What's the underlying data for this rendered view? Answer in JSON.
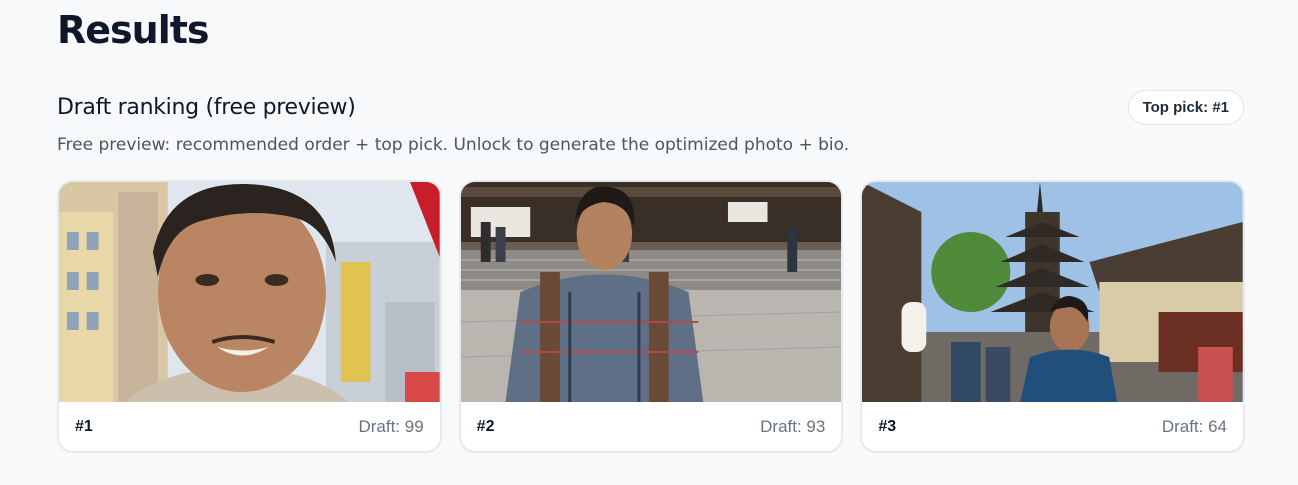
{
  "page": {
    "title": "Results"
  },
  "section": {
    "title": "Draft ranking (free preview)",
    "badge": "Top pick: #1",
    "description": "Free preview: recommended order + top pick. Unlock to generate the optimized photo + bio."
  },
  "cards": [
    {
      "rank": "#1",
      "score": "Draft: 99",
      "photo": "selfie-city-street-photo"
    },
    {
      "rank": "#2",
      "score": "Draft: 93",
      "photo": "temple-courtyard-plaid-shirt-photo"
    },
    {
      "rank": "#3",
      "score": "Draft: 64",
      "photo": "pagoda-street-photo"
    }
  ],
  "colors": {
    "background": "#f8f9fb",
    "card_border": "#e6e9ee",
    "text": "#0f172a",
    "muted": "#6b7280"
  }
}
